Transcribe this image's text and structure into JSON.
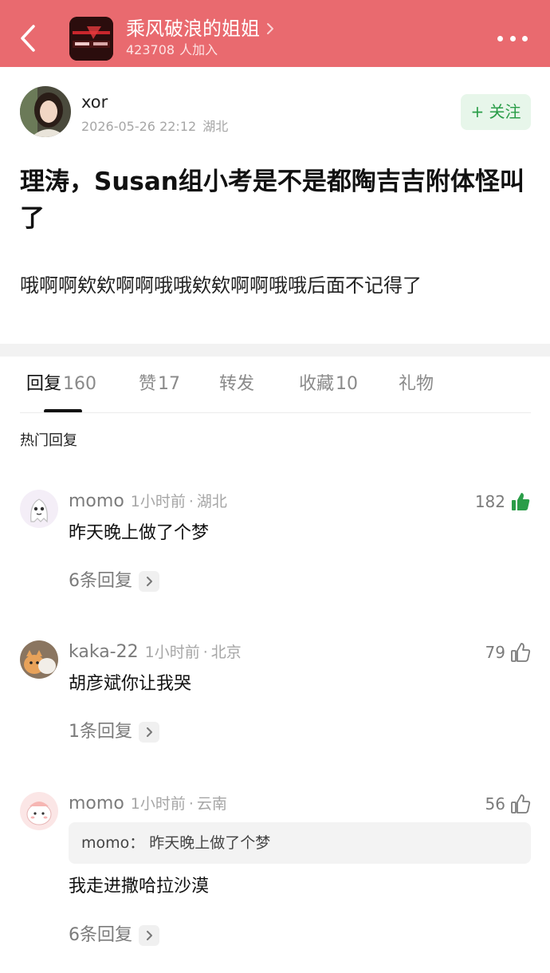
{
  "header": {
    "group_name": "乘风破浪的姐姐",
    "member_count": "423708",
    "member_suffix": "人加入",
    "bg_color": "#e96a6f"
  },
  "post": {
    "author": "xor",
    "date": "2026-05-26 22:12",
    "location": "湖北",
    "follow_label": "+ 关注",
    "title": "理涛，Susan组小考是不是都陶吉吉附体怪叫了",
    "body": "哦啊啊欸欸啊啊哦哦欸欸啊啊哦哦后面不记得了"
  },
  "tabs": [
    {
      "label": "回复",
      "count": "160"
    },
    {
      "label": "赞",
      "count": "17"
    },
    {
      "label": "转发",
      "count": ""
    },
    {
      "label": "收藏",
      "count": "10"
    },
    {
      "label": "礼物",
      "count": ""
    }
  ],
  "hot_section_title": "热门回复",
  "comments": [
    {
      "user": "momo",
      "time": "1小时前",
      "location": "湖北",
      "likes": "182",
      "liked": true,
      "quote": "",
      "text": "昨天晚上做了个梦",
      "replies": "6条回复"
    },
    {
      "user": "kaka-22",
      "time": "1小时前",
      "location": "北京",
      "likes": "79",
      "liked": false,
      "quote": "",
      "text": "胡彦斌你让我哭",
      "replies": "1条回复"
    },
    {
      "user": "momo",
      "time": "1小时前",
      "location": "云南",
      "likes": "56",
      "liked": false,
      "quote": "momo： 昨天晚上做了个梦",
      "text": "我走进撒哈拉沙漠",
      "replies": "6条回复"
    }
  ],
  "colors": {
    "accent_green": "#2a9d48",
    "follow_bg": "#e7f6ea",
    "muted_text": "#a6a6a6"
  }
}
